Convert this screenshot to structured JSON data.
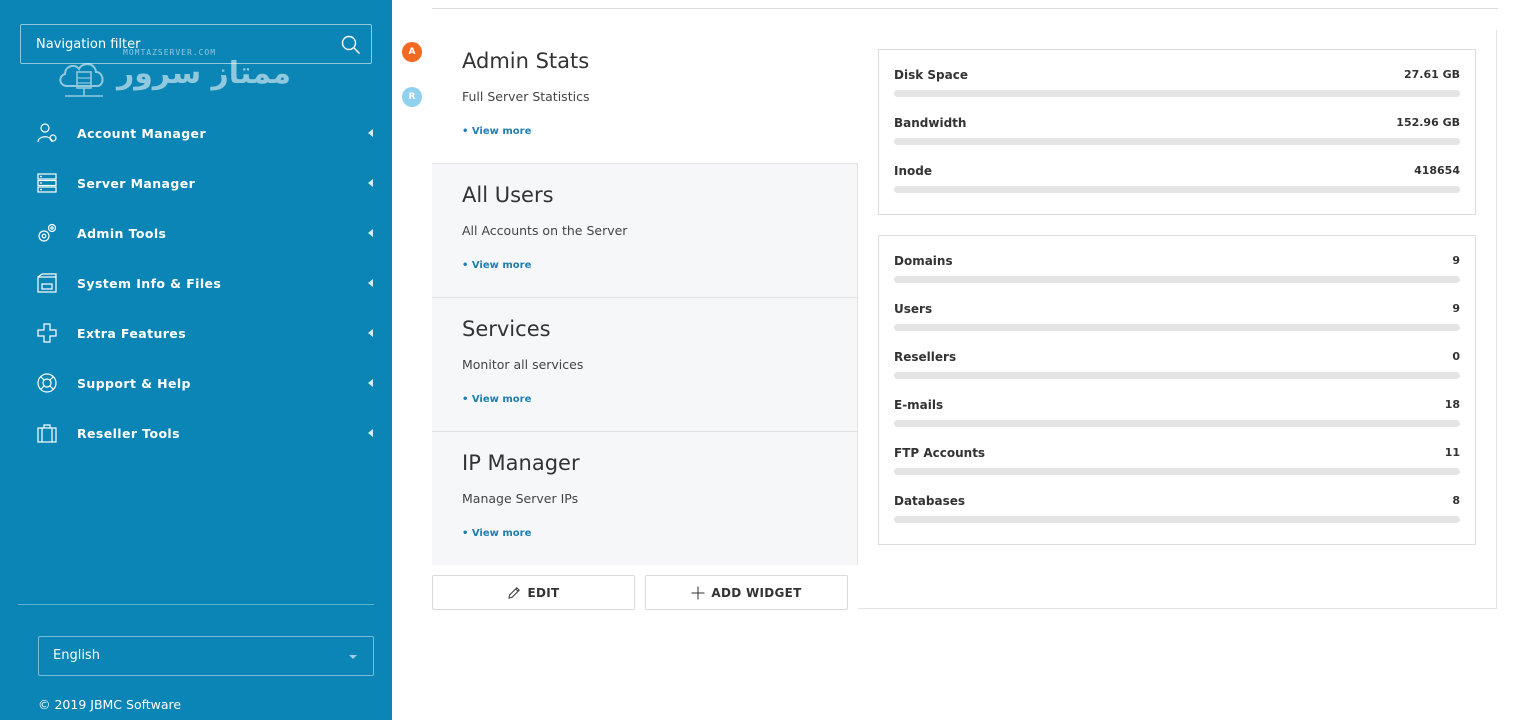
{
  "sidebar": {
    "filter_placeholder": "Navigation filter",
    "logo_text": "ممتاز سرور",
    "logo_subtext": "MOMTAZSERVER.COM",
    "items": [
      {
        "label": "Account Manager",
        "icon": "users-gear-icon"
      },
      {
        "label": "Server Manager",
        "icon": "server-icon"
      },
      {
        "label": "Admin Tools",
        "icon": "gears-icon"
      },
      {
        "label": "System Info & Files",
        "icon": "files-icon"
      },
      {
        "label": "Extra Features",
        "icon": "plus-icon"
      },
      {
        "label": "Support & Help",
        "icon": "lifebuoy-icon"
      },
      {
        "label": "Reseller Tools",
        "icon": "briefcase-icon"
      }
    ],
    "language": "English",
    "copyright": "© 2019 JBMC Software"
  },
  "badges": {
    "a": "A",
    "r": "R"
  },
  "tabs": [
    {
      "title": "Admin Stats",
      "description": "Full Server Statistics",
      "more": "• View more"
    },
    {
      "title": "All Users",
      "description": "All Accounts on the Server",
      "more": "• View more"
    },
    {
      "title": "Services",
      "description": "Monitor all services",
      "more": "• View more"
    },
    {
      "title": "IP Manager",
      "description": "Manage Server IPs",
      "more": "• View more"
    }
  ],
  "buttons": {
    "edit": "EDIT",
    "add_widget": "ADD WIDGET"
  },
  "resources": [
    {
      "label": "Disk Space",
      "value": "27.61 GB",
      "fill": 0
    },
    {
      "label": "Bandwidth",
      "value": "152.96 GB",
      "fill": 0
    },
    {
      "label": "Inode",
      "value": "418654",
      "fill": 0
    }
  ],
  "counts": [
    {
      "label": "Domains",
      "value": "9",
      "fill": 0
    },
    {
      "label": "Users",
      "value": "9",
      "fill": 0
    },
    {
      "label": "Resellers",
      "value": "0",
      "fill": 0
    },
    {
      "label": "E-mails",
      "value": "18",
      "fill": 0
    },
    {
      "label": "FTP Accounts",
      "value": "11",
      "fill": 0
    },
    {
      "label": "Databases",
      "value": "8",
      "fill": 0
    }
  ],
  "colors": {
    "sidebar": "#0a85b5",
    "badge_a": "#f26a21",
    "badge_r": "#8fd1ef",
    "link": "#1e7fb0"
  }
}
